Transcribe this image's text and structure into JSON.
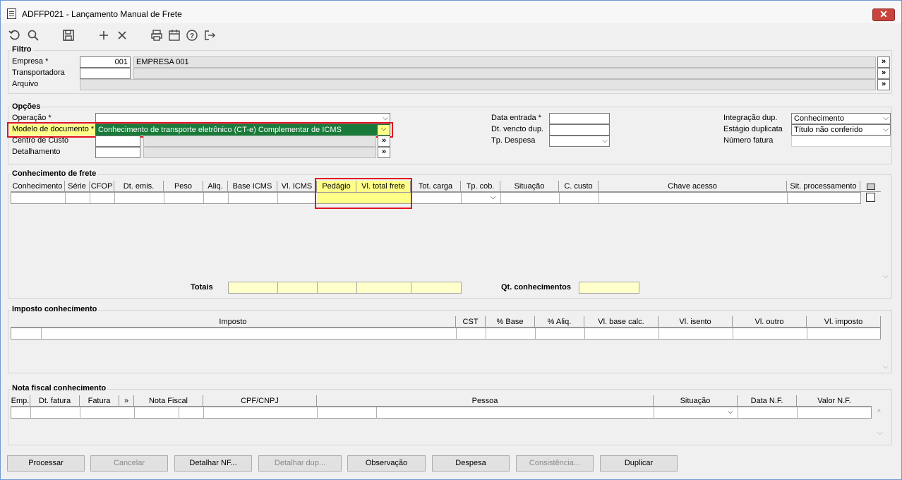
{
  "window": {
    "title": "ADFFP021 - Lançamento Manual de Frete"
  },
  "toolbar": {
    "icons": [
      "undo-icon",
      "search-icon",
      "save-icon",
      "add-icon",
      "delete-icon",
      "print-icon",
      "calendar-icon",
      "help-icon",
      "exit-icon"
    ]
  },
  "filtro": {
    "title": "Filtro",
    "empresa_label": "Empresa *",
    "empresa_code": "001",
    "empresa_name": "EMPRESA 001",
    "transportadora_label": "Transportadora",
    "arquivo_label": "Arquivo",
    "lookup_btn": "»"
  },
  "opcoes": {
    "title": "Opções",
    "operacao_label": "Operação *",
    "modelo_label": "Modelo de documento *",
    "modelo_value": "Conhecimento de transporte eletrônico (CT-e) Complementar de ICMS",
    "centro_custo_label": "Centro de Custo",
    "detalhamento_label": "Detalhamento",
    "data_entrada_label": "Data entrada *",
    "dt_vencto_label": "Dt. vencto dup.",
    "tp_despesa_label": "Tp. Despesa",
    "integracao_label": "Integração dup.",
    "integracao_value": "Conhecimento",
    "estagio_label": "Estágio duplicata",
    "estagio_value": "Título não conferido",
    "numero_fatura_label": "Número fatura"
  },
  "conhecimento": {
    "title": "Conhecimento de frete",
    "columns": [
      "Conhecimento",
      "Série",
      "CFOP",
      "Dt. emis.",
      "Peso",
      "Aliq.",
      "Base ICMS",
      "Vl. ICMS",
      "Pedágio",
      "Vl. total frete",
      "Tot. carga",
      "Tp. cob.",
      "Situação",
      "C. custo",
      "Chave acesso",
      "Sit. processamento"
    ],
    "totais_label": "Totais",
    "qt_label": "Qt. conhecimentos"
  },
  "imposto": {
    "title": "Imposto conhecimento",
    "columns": [
      "Imposto",
      "CST",
      "% Base",
      "% Aliq.",
      "Vl. base calc.",
      "Vl. isento",
      "Vl. outro",
      "Vl. imposto"
    ]
  },
  "nota_fiscal": {
    "title": "Nota fiscal conhecimento",
    "columns": [
      "Emp.",
      "Dt. fatura",
      "Fatura",
      "»",
      "Nota Fiscal",
      "CPF/CNPJ",
      "Pessoa",
      "Situação",
      "Data N.F.",
      "Valor N.F."
    ]
  },
  "buttons": {
    "processar": "Processar",
    "cancelar": "Cancelar",
    "detalhar_nf": "Detalhar NF...",
    "detalhar_dup": "Detalhar dup...",
    "observacao": "Observação",
    "despesa": "Despesa",
    "consistencia": "Consistência...",
    "duplicar": "Duplicar"
  },
  "colors": {
    "highlight_yellow": "#ffff88",
    "highlight_red": "#e0141e",
    "modelo_bg": "#1a7a3a",
    "window_border": "#6b9bd2"
  }
}
